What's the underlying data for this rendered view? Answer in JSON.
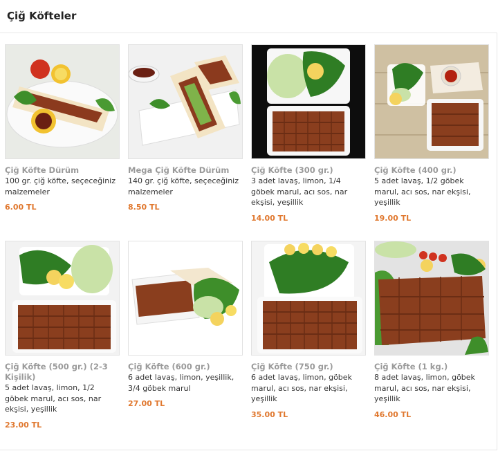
{
  "header": {
    "title": "Çiğ Köfteler"
  },
  "products": [
    {
      "name": "Çiğ Köfte Dürüm",
      "desc": "100 gr. çiğ köfte, seçeceğiniz malzemeler",
      "price": "6.00 TL",
      "image": "wrap-plate-image"
    },
    {
      "name": "Mega Çiğ Köfte Dürüm",
      "desc": "140 gr. çiğ köfte, seçeceğiniz malzemeler",
      "price": "8.50 TL",
      "image": "wrap-plate-image"
    },
    {
      "name": "Çiğ Köfte (300 gr.)",
      "desc": "3 adet lavaş, limon, 1/4 göbek marul, acı sos, nar ekşisi, yeşillik",
      "price": "14.00 TL",
      "image": "tray-image"
    },
    {
      "name": "Çiğ Köfte (400 gr.)",
      "desc": "5 adet lavaş, 1/2 göbek marul, acı sos, nar ekşisi, yeşillik",
      "price": "19.00 TL",
      "image": "tray-image"
    },
    {
      "name": "Çiğ Köfte (500 gr.) (2-3 Kişilik)",
      "desc": "5 adet lavaş, limon, 1/2 göbek marul, acı sos, nar ekşisi, yeşillik",
      "price": "23.00 TL",
      "image": "tray-image"
    },
    {
      "name": "Çiğ Köfte (600 gr.)",
      "desc": "6 adet lavaş, limon, yeşillik, 3/4 göbek marul",
      "price": "27.00 TL",
      "image": "tray-image"
    },
    {
      "name": "Çiğ Köfte (750 gr.)",
      "desc": "6 adet lavaş, limon, göbek marul, acı sos, nar ekşisi, yeşillik",
      "price": "35.00 TL",
      "image": "tray-image"
    },
    {
      "name": "Çiğ Köfte (1 kg.)",
      "desc": "8 adet lavaş, limon, göbek marul, acı sos, nar ekşisi, yeşillik",
      "price": "46.00 TL",
      "image": "platter-image"
    }
  ]
}
